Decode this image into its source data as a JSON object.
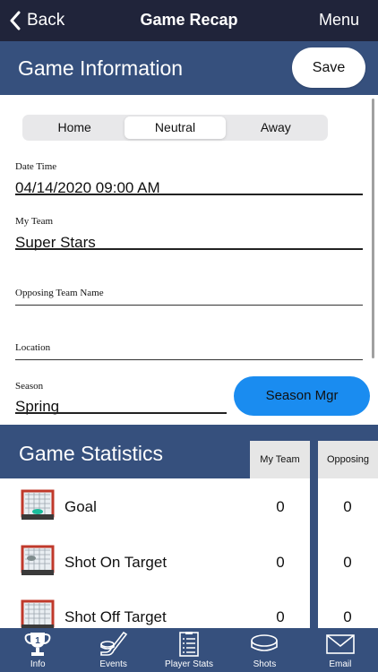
{
  "nav": {
    "back_label": "Back",
    "title": "Game Recap",
    "menu_label": "Menu"
  },
  "game_info": {
    "title": "Game Information",
    "save_label": "Save",
    "segments": [
      {
        "label": "Home",
        "selected": false
      },
      {
        "label": "Neutral",
        "selected": true
      },
      {
        "label": "Away",
        "selected": false
      }
    ],
    "date_time": {
      "label": "Date Time",
      "value": "04/14/2020 09:00 AM"
    },
    "my_team": {
      "label": "My Team",
      "value": "Super Stars"
    },
    "opposing_team": {
      "label": "Opposing Team Name",
      "value": ""
    },
    "location": {
      "label": "Location",
      "value": ""
    },
    "season": {
      "label": "Season",
      "value": "Spring"
    },
    "season_mgr_label": "Season Mgr"
  },
  "stats": {
    "title": "Game Statistics",
    "columns": [
      "My Team",
      "Opposing"
    ],
    "rows": [
      {
        "label": "Goal",
        "icon": "goal-net-icon",
        "mine": "0",
        "opp": "0"
      },
      {
        "label": "Shot On Target",
        "icon": "net-target-icon",
        "mine": "0",
        "opp": "0"
      },
      {
        "label": "Shot Off Target",
        "icon": "net-miss-icon",
        "mine": "0",
        "opp": "0"
      }
    ]
  },
  "tabbar": {
    "tabs": [
      {
        "label": "Info",
        "icon": "trophy-icon",
        "active": true
      },
      {
        "label": "Events",
        "icon": "hockey-stick-icon",
        "active": false
      },
      {
        "label": "Player Stats",
        "icon": "clipboard-icon",
        "active": false
      },
      {
        "label": "Shots",
        "icon": "puck-icon",
        "active": false
      },
      {
        "label": "Email",
        "icon": "envelope-icon",
        "active": false
      }
    ]
  },
  "colors": {
    "nav_bg": "#20243a",
    "section_bg": "#36507d",
    "accent_blue": "#1a8cf0"
  }
}
